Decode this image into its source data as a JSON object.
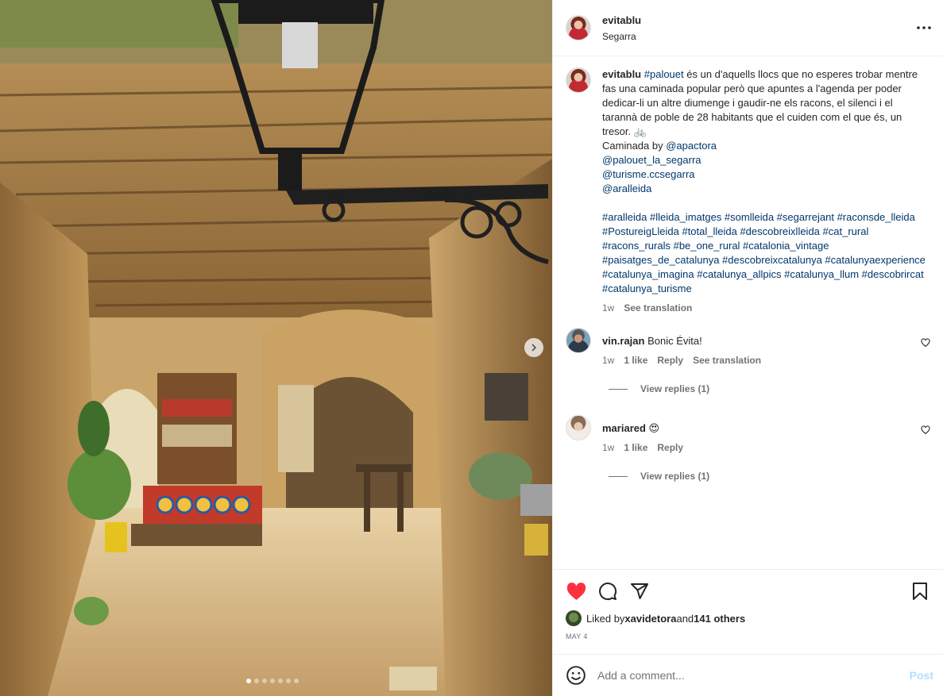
{
  "post": {
    "username": "evitablu",
    "location": "Segarra",
    "photo_alt": "Stone arched passage with wooden beam ceiling, wrought-iron lantern, bookshelf and plants",
    "carousel_total": 7,
    "carousel_active": 1
  },
  "caption": {
    "username": "evitablu",
    "hashtag_intro": "#palouet",
    "text": " és un d'aquells llocs que no esperes trobar mentre fas una caminada popular però que apuntes a l'agenda per poder dedicar-li un altre diumenge i gaudir-ne els racons, el silenci i el tarannà de poble de 28 habitants que el cuiden com el que és, un tresor. 🚲",
    "caminada": "Caminada by ",
    "mentions": [
      "@apactora",
      "@palouet_la_segarra",
      "@turisme.ccsegarra",
      "@aralleida"
    ],
    "hashtags": "#aralleida #lleida_imatges #somlleida #segarrejant #raconsde_lleida #PostureigLleida #total_lleida #descobreixlleida #cat_rural #racons_rurals #be_one_rural #catalonia_vintage #paisatges_de_catalunya #descobreixcatalunya #catalunyaexperience #catalunya_imagina #catalunya_allpics #catalunya_llum #descobrircat #catalunya_turisme",
    "time": "1w",
    "see_translation": "See translation"
  },
  "comments": [
    {
      "username": "vin.rajan",
      "text": "Bonic Évita!",
      "time": "1w",
      "likes": "1 like",
      "reply": "Reply",
      "see_translation": "See translation",
      "view_replies": "View replies (1)"
    },
    {
      "username": "mariared",
      "text": "😍",
      "time": "1w",
      "likes": "1 like",
      "reply": "Reply",
      "view_replies": "View replies (1)"
    }
  ],
  "likes": {
    "prefix": "Liked by ",
    "user": "xavidetora",
    "and": " and ",
    "others": "141 others"
  },
  "date": "MAY 4",
  "composer": {
    "placeholder": "Add a comment...",
    "post_label": "Post"
  },
  "colors": {
    "like_red": "#ff3040",
    "link_blue": "#00376b",
    "post_disabled": "#b2dffc",
    "meta_gray": "#737373"
  },
  "icons": [
    "more-icon",
    "heart-filled-icon",
    "comment-icon",
    "share-icon",
    "bookmark-icon",
    "emoji-icon",
    "chevron-right-icon",
    "heart-outline-icon"
  ]
}
